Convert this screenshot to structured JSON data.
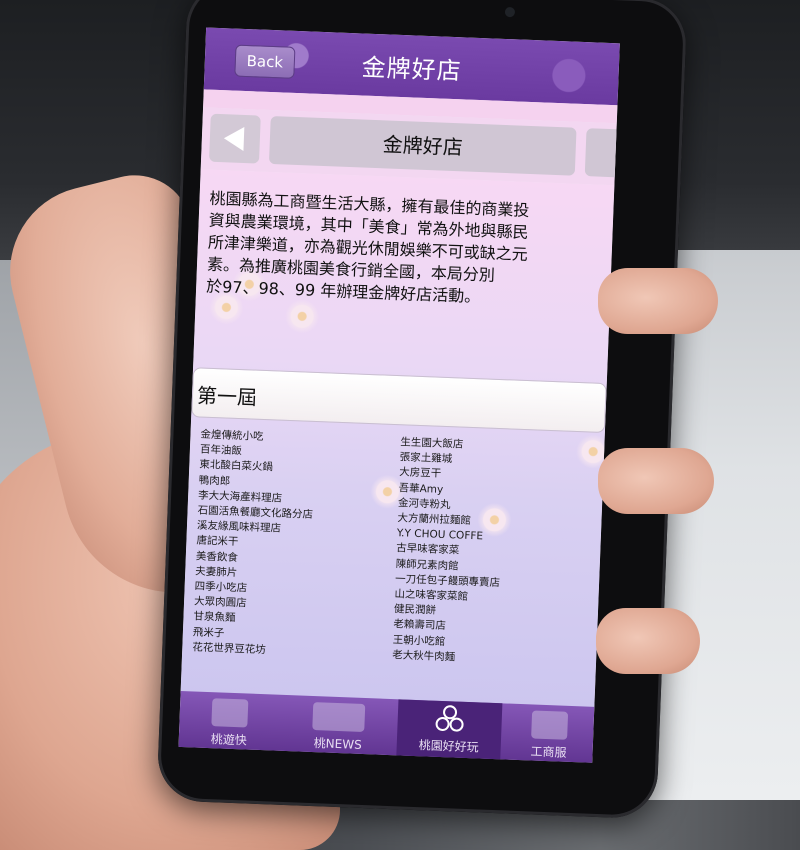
{
  "header": {
    "back_label": "Back",
    "title": "金牌好店"
  },
  "tabs": {
    "current_label": "金牌好店"
  },
  "intro_text": "桃園縣為工商暨生活大縣，擁有最佳的商業投\n資與農業環境，其中「美食」常為外地與縣民\n所津津樂道，亦為觀光休閒娛樂不可或缺之元\n素。為推廣桃園美食行銷全國，本局分別\n於97、98、99 年辦理金牌好店活動。",
  "section": {
    "title": "第一屆"
  },
  "stores_left": [
    "金煌傳統小吃",
    "百年油飯",
    "東北酸白菜火鍋",
    "鴨肉郎",
    "李大大海產料理店",
    "石園活魚餐廳文化路分店",
    "溪友緣風味料理店",
    "唐記米干",
    "美香飲食",
    "夫妻肺片",
    "四季小吃店",
    "大眾肉圓店",
    "甘泉魚麵",
    "飛米子",
    "花花世界豆花坊"
  ],
  "stores_right": [
    "生生園大飯店",
    "張家土雞城",
    "大房豆干",
    "吾華Amy",
    "金河寺粉丸",
    "大方蘭州拉麵館",
    "Y.Y CHOU COFFE",
    "古早味客家菜",
    "陳師兄素肉館",
    "一刀任包子饅頭專賣店",
    "山之味客家菜館",
    "健民潤餅",
    "老賴壽司店",
    "王朝小吃館",
    "老大秋牛肉麵"
  ],
  "bottom_nav": [
    {
      "label": "桃遊快",
      "icon": "folder-icon"
    },
    {
      "label": "桃NEWS",
      "icon": "newspaper-icon"
    },
    {
      "label": "桃園好好玩",
      "icon": "taoyuan-logo-icon",
      "active": true
    },
    {
      "label": "工商服",
      "icon": "megaphone-icon"
    }
  ],
  "colors": {
    "header_purple": "#6a3aa0",
    "pink_bar": "#f5d2ef",
    "nav_active": "#4a2378"
  }
}
